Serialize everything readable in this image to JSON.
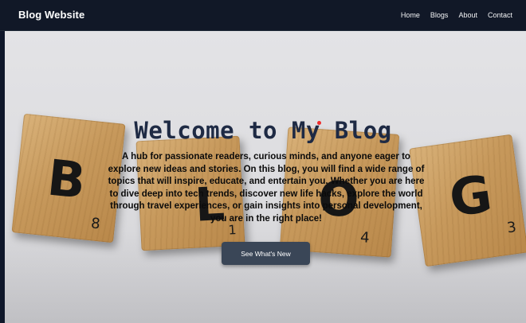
{
  "navbar": {
    "brand": "Blog Website",
    "links": [
      "Home",
      "Blogs",
      "About",
      "Contact"
    ]
  },
  "hero": {
    "title": "Welcome to My Blog",
    "description": "A hub for passionate readers, curious minds, and anyone eager to explore new ideas and stories. On this blog, you will find a wide range of topics that will inspire, educate, and entertain you. Whether you are here to dive deep into tech trends, discover new life hacks, explore the world through travel experiences, or gain insights into personal development, you are in the right place!",
    "button_label": "See What's New",
    "tiles": [
      {
        "letter": "B",
        "number": "8"
      },
      {
        "letter": "L",
        "number": "1"
      },
      {
        "letter": "O",
        "number": "4"
      },
      {
        "letter": "G",
        "number": "3"
      }
    ]
  },
  "colors": {
    "navbar_bg": "#111827",
    "button_bg": "#3a4657",
    "title_color": "#1e2a44",
    "accent_dot": "#ef2b2b"
  }
}
